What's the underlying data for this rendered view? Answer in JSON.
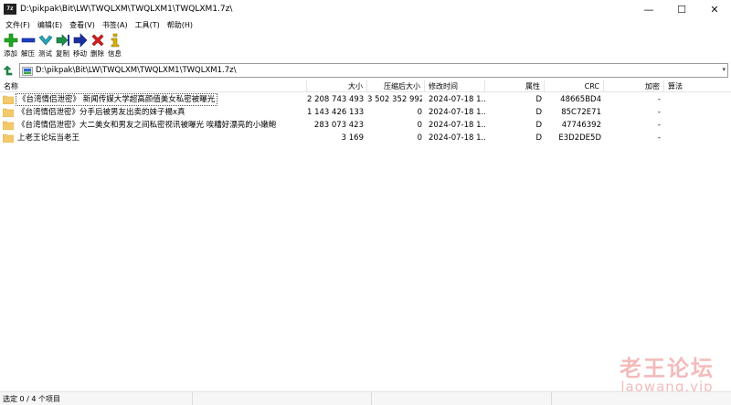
{
  "window": {
    "title": "D:\\pikpak\\Bit\\LW\\TWQLXM\\TWQLXM1\\TWQLXM1.7z\\",
    "app_icon_text": "7z",
    "controls": [
      "—",
      "☐",
      "✕"
    ]
  },
  "menu": [
    "文件(F)",
    "编辑(E)",
    "查看(V)",
    "书签(A)",
    "工具(T)",
    "帮助(H)"
  ],
  "toolbar": [
    {
      "name": "add",
      "label": "添加",
      "icon": "plus-icon",
      "color": "#1fa81f"
    },
    {
      "name": "extract",
      "label": "解压",
      "icon": "minus-icon",
      "color": "#1c3fbf"
    },
    {
      "name": "test",
      "label": "测试",
      "icon": "check-icon",
      "color": "#2aa3b8"
    },
    {
      "name": "copy",
      "label": "复制",
      "icon": "double-arrow-icon",
      "color": "#1e8f4a"
    },
    {
      "name": "move",
      "label": "移动",
      "icon": "arrow-right-icon",
      "color": "#1c2f9f"
    },
    {
      "name": "delete",
      "label": "删除",
      "icon": "x-icon",
      "color": "#d81e1e"
    },
    {
      "name": "info",
      "label": "信息",
      "icon": "info-icon",
      "color": "#d8b400"
    }
  ],
  "address": {
    "path": "D:\\pikpak\\Bit\\LW\\TWQLXM\\TWQLXM1\\TWQLXM1.7z\\"
  },
  "columns": {
    "name": "名称",
    "size": "大小",
    "packed": "压缩后大小",
    "modified": "修改时间",
    "attr": "属性",
    "crc": "CRC",
    "encrypted": "加密",
    "method": "算法"
  },
  "files": [
    {
      "name": "《台湾情侣泄密》 新闻传媒大学超高颜值美女私密被曝光",
      "size": "2 208 743 493",
      "packed": "3 502 352 992",
      "modified": "2024-07-18 1...",
      "attr": "D",
      "crc": "48665BD4",
      "encrypted": "-",
      "method": ""
    },
    {
      "name": "《台湾情侣泄密》分手后被男友出卖的妹子楊x真",
      "size": "1 143 426 133",
      "packed": "0",
      "modified": "2024-07-18 1...",
      "attr": "D",
      "crc": "85C72E71",
      "encrypted": "-",
      "method": ""
    },
    {
      "name": "《台湾情侣泄密》大二美女和男友之间私密视讯被曝光 唉糟好漂亮的小嫩鲍",
      "size": "283 073 423",
      "packed": "0",
      "modified": "2024-07-18 1...",
      "attr": "D",
      "crc": "47746392",
      "encrypted": "-",
      "method": ""
    },
    {
      "name": "上老王论坛当老王",
      "size": "3 169",
      "packed": "0",
      "modified": "2024-07-18 1...",
      "attr": "D",
      "crc": "E3D2DE5D",
      "encrypted": "-",
      "method": ""
    }
  ],
  "watermark": {
    "cn": "老王论坛",
    "en": "laowang.vip"
  },
  "status": {
    "selection": "选定 0 / 4 个项目"
  },
  "colors": {
    "folder": "#f3c96b",
    "folder_dark": "#e2ad3f",
    "border": "#e4e4e4"
  }
}
